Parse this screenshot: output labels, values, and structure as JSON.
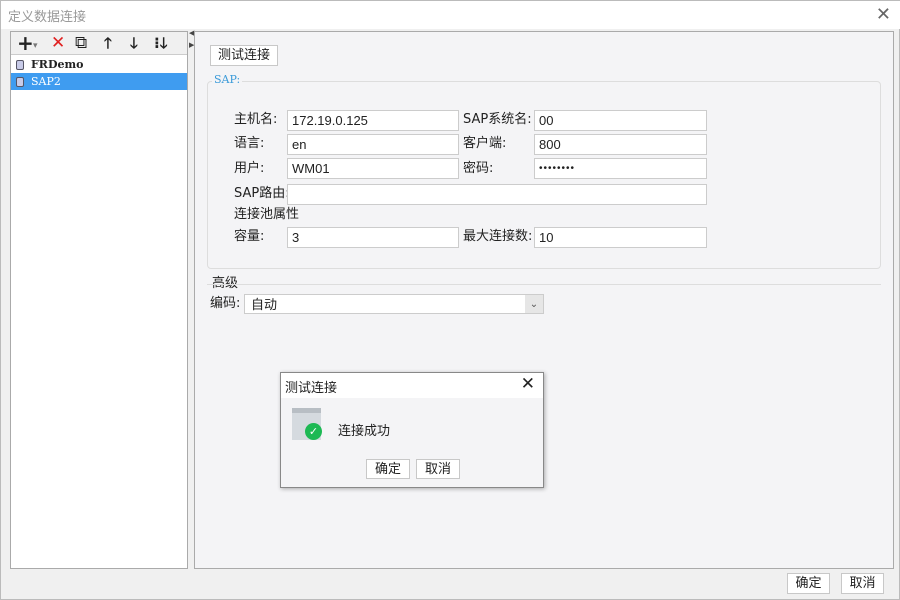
{
  "window": {
    "title": "定义数据连接",
    "close_icon": "close-icon"
  },
  "toolbar": {
    "add": "+",
    "add_arrow": "▾",
    "delete": "✕",
    "copy": "⧉",
    "up": "🡑",
    "down": "🡓",
    "sort": "⁝🡓"
  },
  "connections": [
    {
      "name": "FRDemo",
      "selected": false
    },
    {
      "name": "SAP2",
      "selected": true
    }
  ],
  "main": {
    "test_button": "测试连接",
    "group_title": "SAP:",
    "fields": {
      "host_label": "主机名:",
      "host": "172.19.0.125",
      "sysname_label": "SAP系统名:",
      "sysname": "00",
      "lang_label": "语言:",
      "lang": "en",
      "client_label": "客户端:",
      "client": "800",
      "user_label": "用户:",
      "user": "WM01",
      "password_label": "密码:",
      "password": "••••••••",
      "router_label": "SAP路由:",
      "router": "",
      "pool_title": "连接池属性",
      "capacity_label": "容量:",
      "capacity": "3",
      "maxconn_label": "最大连接数:",
      "maxconn": "10"
    },
    "advanced_title": "高级",
    "encoding_label": "编码:",
    "encoding": "自动"
  },
  "footer": {
    "ok": "确定",
    "cancel": "取消"
  },
  "dialog": {
    "title": "测试连接",
    "message": "连接成功",
    "ok": "确定",
    "cancel": "取消",
    "success_color": "#1db954"
  }
}
